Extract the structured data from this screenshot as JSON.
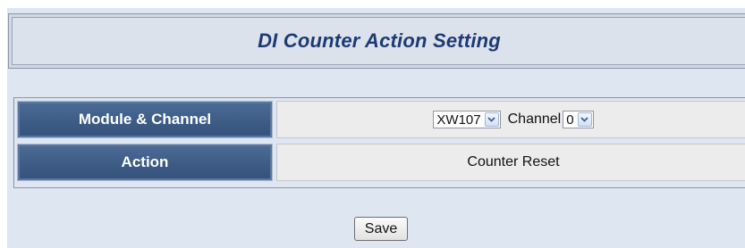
{
  "title": "DI Counter Action Setting",
  "rows": {
    "module_channel": {
      "label": "Module & Channel",
      "module_selected": "XW107",
      "channel_label": "Channel",
      "channel_selected": "0"
    },
    "action": {
      "label": "Action",
      "value": "Counter Reset"
    }
  },
  "buttons": {
    "save": "Save"
  },
  "colors": {
    "panel_bg": "#dde6f1",
    "header_cell_bg": "#3d5c86",
    "title_text": "#1e3a73",
    "value_cell_bg": "#ececec"
  },
  "icons": {
    "dropdown": "chevron-down-icon"
  }
}
